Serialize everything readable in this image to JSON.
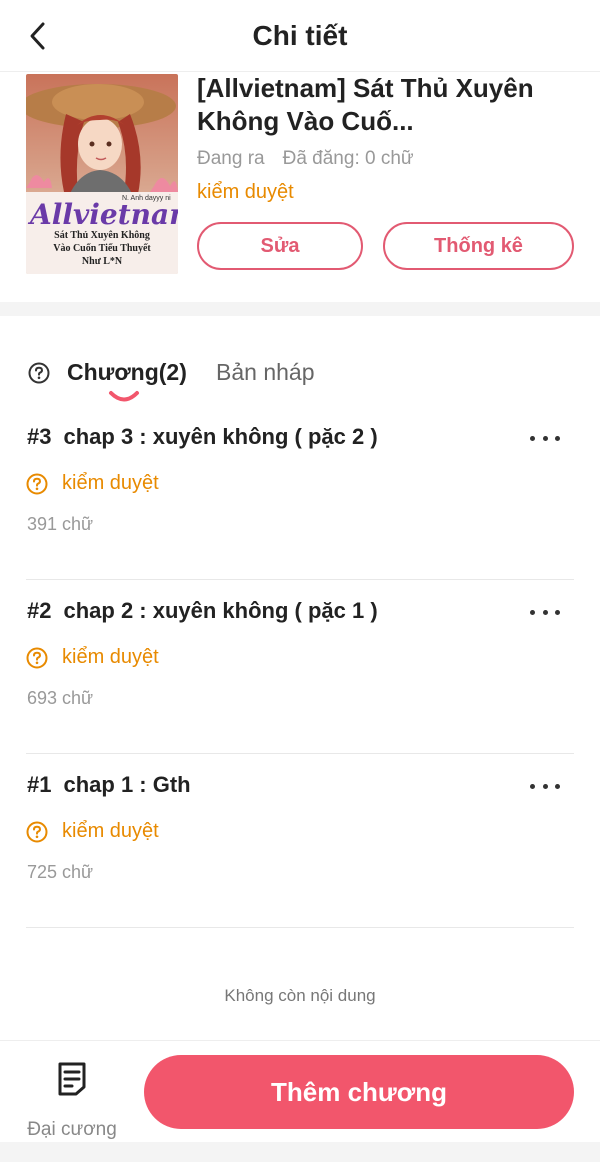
{
  "header": {
    "title": "Chi tiết"
  },
  "book": {
    "title": "[Allvietnam] Sát Thủ Xuyên Không Vào Cuố...",
    "meta_status": "Đang ra",
    "meta_words": "Đã đăng: 0 chữ",
    "review_status": "kiểm duyệt",
    "cover": {
      "logo_text": "Allvietnam",
      "credit": "N. Anh dayyy ni",
      "subtitle_line1": "Sát Thủ Xuyên Không",
      "subtitle_line2": "Vào Cuốn Tiểu Thuyết",
      "subtitle_line3": "Như L*N"
    },
    "edit_label": "Sửa",
    "stats_label": "Thống kê"
  },
  "tabs": {
    "chapters_label": "Chương(2)",
    "drafts_label": "Bản nháp"
  },
  "chapters": [
    {
      "num": "#3",
      "title": "chap 3 : xuyên không ( pặc 2 )",
      "status": "kiểm duyệt",
      "words": "391 chữ"
    },
    {
      "num": "#2",
      "title": "chap 2 : xuyên không ( pặc 1 )",
      "status": "kiểm duyệt",
      "words": "693 chữ"
    },
    {
      "num": "#1",
      "title": "chap 1 : Gth",
      "status": "kiểm duyệt",
      "words": "725 chữ"
    }
  ],
  "end_note": "Không còn nội dung",
  "bottom": {
    "outline_label": "Đại cương",
    "add_chapter_label": "Thêm chương"
  },
  "colors": {
    "accent": "#f2566c",
    "outline_accent": "#e25a72",
    "review": "#e88a00"
  },
  "icons": {
    "back": "chevron-left-icon",
    "help": "question-circle-icon",
    "review": "question-circle-icon",
    "more": "more-horizontal-icon",
    "outline": "document-icon"
  }
}
